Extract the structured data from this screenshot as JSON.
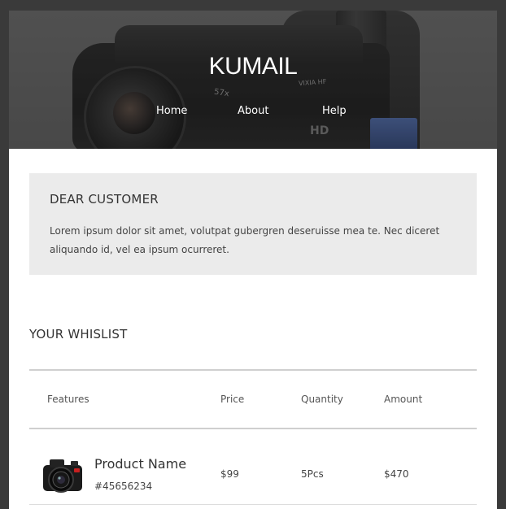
{
  "header": {
    "logo": "KUMAIL",
    "nav": [
      {
        "label": "Home"
      },
      {
        "label": "About"
      },
      {
        "label": "Help"
      }
    ],
    "hero_image": "camcorder-photo"
  },
  "notice": {
    "title": "DEAR CUSTOMER",
    "body": "Lorem ipsum dolor sit amet, volutpat gubergren deseruisse mea te. Nec diceret aliquando id, vel ea ipsum ocurreret."
  },
  "wishlist": {
    "title": "YOUR WHISLIST",
    "columns": [
      "Features",
      "Price",
      "Quantity",
      "Amount"
    ],
    "rows": [
      {
        "product_name": "Product Name",
        "sku": "#45656234",
        "price": "$99",
        "quantity": "5Pcs",
        "amount": "$470",
        "thumbnail": "camera-icon"
      }
    ]
  },
  "colors": {
    "page_bg": "#3a3a3a",
    "card_bg": "#ffffff",
    "notice_bg": "#ebebeb",
    "rule": "#cfcfcf"
  }
}
